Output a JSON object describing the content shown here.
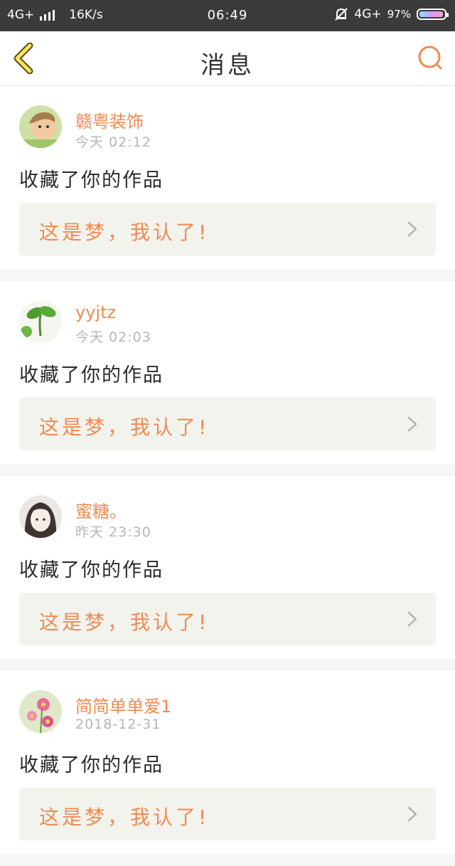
{
  "status_bar": {
    "network": "4G+",
    "speed": "16K/s",
    "time": "06:49",
    "network_right": "4G+",
    "battery": "97%"
  },
  "header": {
    "title": "消息",
    "accent_color": "#f08a52"
  },
  "messages": [
    {
      "username": "赣粤装饰",
      "time": "今天 02:12",
      "action": "收藏了你的作品",
      "work_title": "这是梦，我认了!",
      "avatar": "baby-avatar"
    },
    {
      "username": "yyjtz",
      "time": "今天 02:03",
      "action": "收藏了你的作品",
      "work_title": "这是梦，我认了!",
      "avatar": "leaf-avatar"
    },
    {
      "username": "蜜糖。",
      "time": "昨天 23:30",
      "action": "收藏了你的作品",
      "work_title": "这是梦，我认了!",
      "avatar": "girl-avatar"
    },
    {
      "username": "简简单单爱1",
      "time": "2018-12-31",
      "action": "收藏了你的作品",
      "work_title": "这是梦，我认了!",
      "avatar": "flower-avatar"
    }
  ]
}
